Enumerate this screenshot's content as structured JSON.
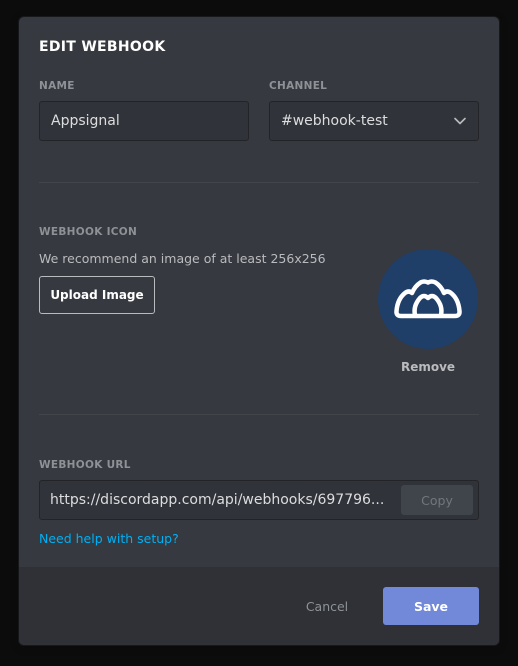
{
  "modal": {
    "title": "EDIT WEBHOOK"
  },
  "name_field": {
    "label": "NAME",
    "value": "Appsignal"
  },
  "channel_field": {
    "label": "CHANNEL",
    "value": "#webhook-test",
    "icon": "chevron-down-icon"
  },
  "icon_section": {
    "label": "WEBHOOK ICON",
    "hint": "We recommend an image of at least 256x256",
    "upload_label": "Upload Image",
    "remove_label": "Remove",
    "avatar_icon": "appsignal-logo-icon"
  },
  "url_section": {
    "label": "WEBHOOK URL",
    "url": "https://discordapp.com/api/webhooks/697796...",
    "copy_label": "Copy",
    "help_link": "Need help with setup?"
  },
  "footer": {
    "cancel_label": "Cancel",
    "save_label": "Save"
  },
  "colors": {
    "modal_bg": "#36393f",
    "footer_bg": "#2f3136",
    "accent": "#7289da",
    "link": "#00b0f4",
    "avatar_bg": "#1f3e68"
  }
}
